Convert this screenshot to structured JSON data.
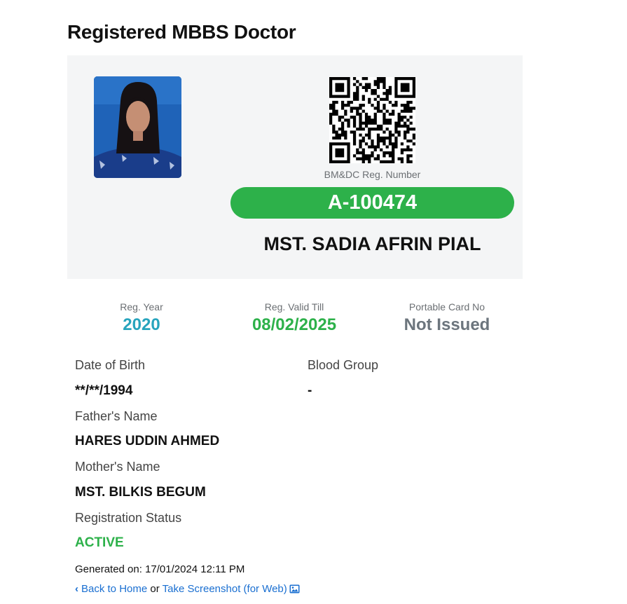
{
  "page": {
    "title": "Registered MBBS Doctor"
  },
  "card": {
    "reg_caption": "BM&DC Reg. Number",
    "reg_number": "A-100474",
    "doctor_name": "MST. SADIA AFRIN PIAL",
    "accent_color": "#2db14a"
  },
  "stats": {
    "reg_year": {
      "label": "Reg. Year",
      "value": "2020"
    },
    "valid_till": {
      "label": "Reg. Valid Till",
      "value": "08/02/2025"
    },
    "portable_card": {
      "label": "Portable Card No",
      "value": "Not Issued"
    }
  },
  "details": {
    "dob": {
      "label": "Date of Birth",
      "value": "**/**/1994"
    },
    "blood_group": {
      "label": "Blood Group",
      "value": "-"
    },
    "father": {
      "label": "Father's Name",
      "value": "HARES UDDIN AHMED"
    },
    "mother": {
      "label": "Mother's Name",
      "value": "MST. BILKIS BEGUM"
    },
    "status": {
      "label": "Registration Status",
      "value": "ACTIVE"
    }
  },
  "footer": {
    "generated": "Generated on: 17/01/2024 12:11 PM",
    "back_link": "Back to Home",
    "or_text": "or",
    "screenshot_link": "Take Screenshot (for Web)"
  }
}
